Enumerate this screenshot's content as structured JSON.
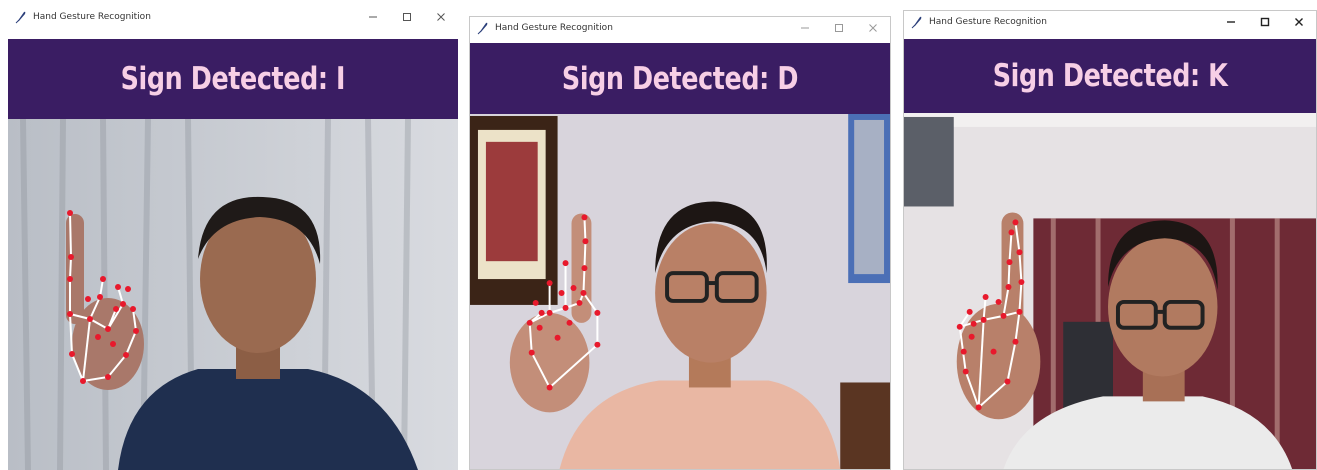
{
  "windows": [
    {
      "title": "Hand Gesture Recognition",
      "controls": {
        "minimize": "–",
        "maximize": "☐",
        "close": "✕"
      },
      "banner": "Sign Detected: I",
      "colors": {
        "banner_bg": "#3a1d63",
        "banner_text": "#f7cfe6",
        "landmark": "#e8192c",
        "connection": "#ffffff"
      }
    },
    {
      "title": "Hand Gesture Recognition",
      "controls": {
        "minimize": "–",
        "maximize": "☐",
        "close": "✕"
      },
      "banner": "Sign Detected: D",
      "colors": {
        "banner_bg": "#3a1d63",
        "banner_text": "#f7cfe6",
        "landmark": "#e8192c",
        "connection": "#ffffff"
      }
    },
    {
      "title": "Hand Gesture Recognition",
      "controls": {
        "minimize": "–",
        "maximize": "☐",
        "close": "✕"
      },
      "banner": "Sign Detected: K",
      "colors": {
        "banner_bg": "#3a1d63",
        "banner_text": "#f7cfe6",
        "landmark": "#e8192c",
        "connection": "#ffffff"
      }
    }
  ],
  "icons": {
    "app": "feather-icon",
    "minimize": "minimize-icon",
    "maximize": "maximize-icon",
    "close": "close-icon"
  }
}
